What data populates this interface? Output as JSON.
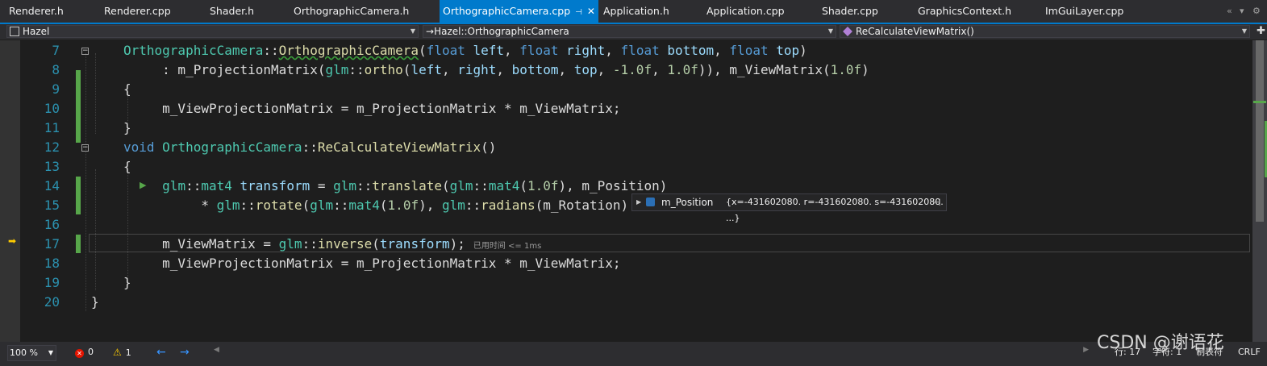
{
  "tabs": [
    {
      "label": "Renderer.h"
    },
    {
      "label": "Renderer.cpp"
    },
    {
      "label": "Shader.h"
    },
    {
      "label": "OrthographicCamera.h"
    },
    {
      "label": "OrthographicCamera.cpp",
      "active": true
    },
    {
      "label": "Application.h"
    },
    {
      "label": "Application.cpp"
    },
    {
      "label": "Shader.cpp"
    },
    {
      "label": "GraphicsContext.h"
    },
    {
      "label": "ImGuiLayer.cpp"
    }
  ],
  "navbar": {
    "project": "Hazel",
    "scope": "Hazel::OrthographicCamera",
    "member": "ReCalculateViewMatrix()"
  },
  "editor": {
    "line_numbers": [
      "7",
      "8",
      "9",
      "10",
      "11",
      "12",
      "13",
      "14",
      "15",
      "16",
      "17",
      "18",
      "19",
      "20"
    ],
    "runtime_hint": "已用时间 <= 1ms",
    "current_line": "17"
  },
  "datatip": {
    "name": "m_Position",
    "value": "{x=-431602080. r=-431602080. s=-431602080. ...}"
  },
  "statusbar": {
    "zoom": "100 %",
    "errors": "0",
    "warnings": "1",
    "line": "行: 17",
    "char": "字符: 1",
    "tabs": "制表符",
    "eol": "CRLF"
  },
  "watermark": "CSDN @谢语花",
  "colors": {
    "accent": "#007acc",
    "keyword": "#569cd6",
    "type": "#4ec9b0",
    "function": "#dcdcaa",
    "parameter": "#9cdcfe",
    "number": "#b5cea8",
    "line_number": "#2b91af",
    "change_bar": "#57a64a"
  }
}
